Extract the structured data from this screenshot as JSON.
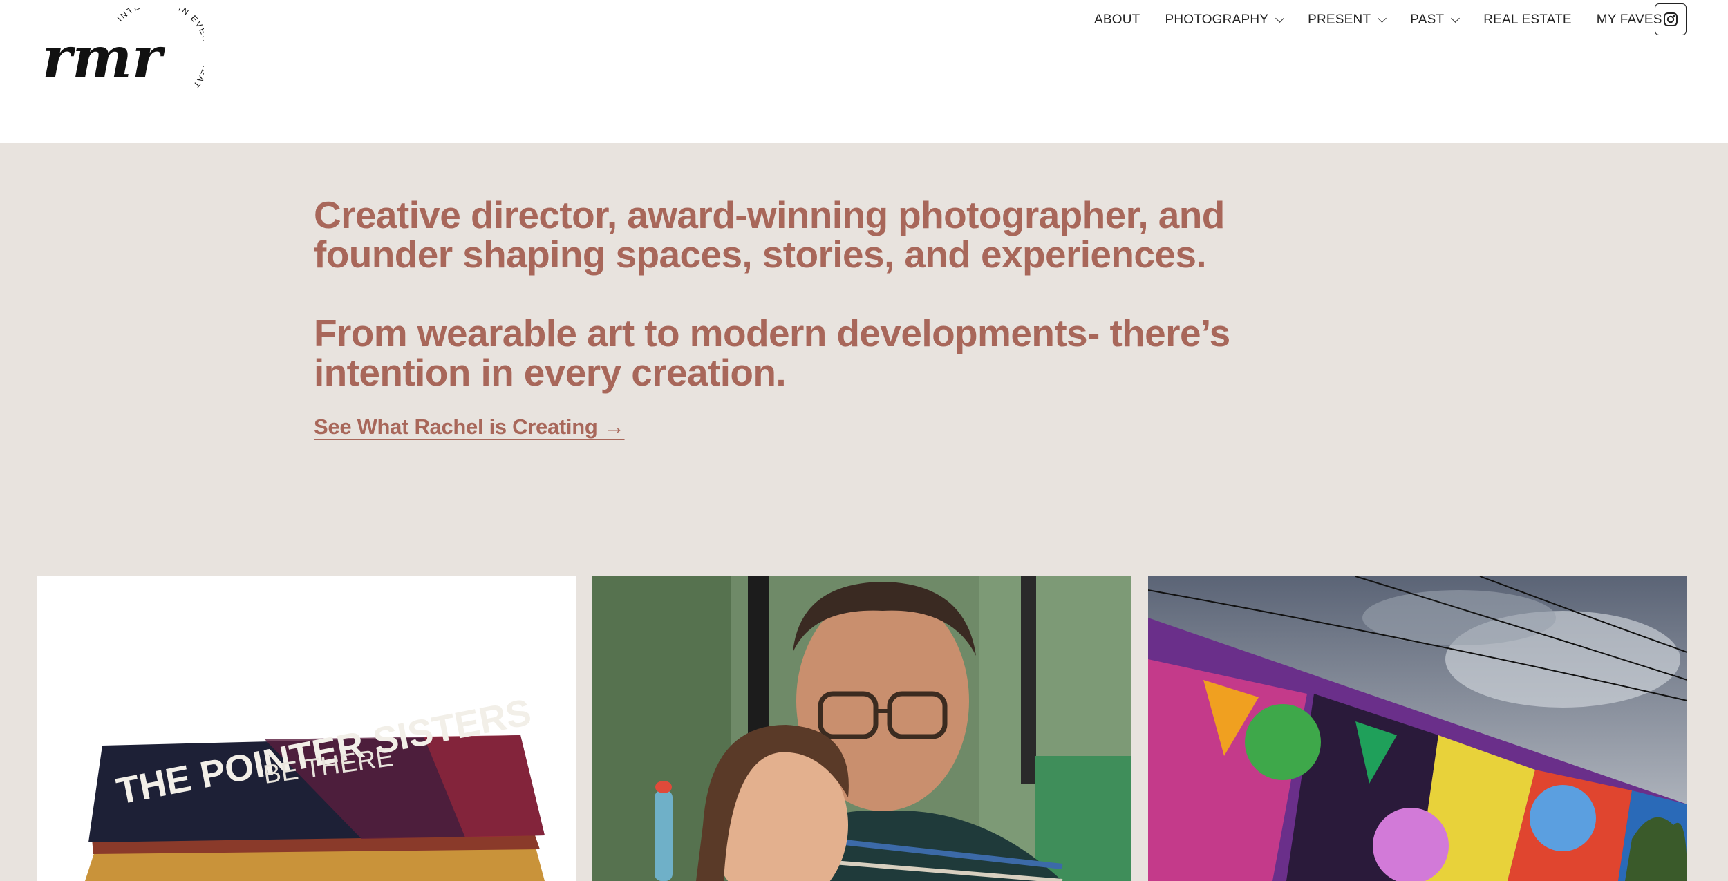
{
  "logo": {
    "wordmark": "rmr",
    "tagline": "INTENTION IN EVERY CREATION"
  },
  "nav": {
    "items": [
      {
        "label": "ABOUT",
        "has_dropdown": false
      },
      {
        "label": "PHOTOGRAPHY",
        "has_dropdown": true
      },
      {
        "label": "PRESENT",
        "has_dropdown": true
      },
      {
        "label": "PAST",
        "has_dropdown": true
      },
      {
        "label": "REAL ESTATE",
        "has_dropdown": false
      },
      {
        "label": "MY FAVES",
        "has_dropdown": false
      }
    ],
    "social_icon": "instagram-icon"
  },
  "hero": {
    "paragraph_1": "Creative director, award-winning photographer, and founder shaping spaces, stories, and experiences.",
    "paragraph_2": "From wearable art to modern developments- there’s intention in every creation.",
    "cta_label": "See What Rachel is Creating →"
  },
  "gallery": {
    "record_text_1": "THE POINTER SISTERS",
    "record_text_2": "BE THERE"
  },
  "colors": {
    "accent": "#a8675a",
    "hero_bg": "#e8e3de",
    "header_bg": "#ffffff",
    "text": "#222222"
  }
}
